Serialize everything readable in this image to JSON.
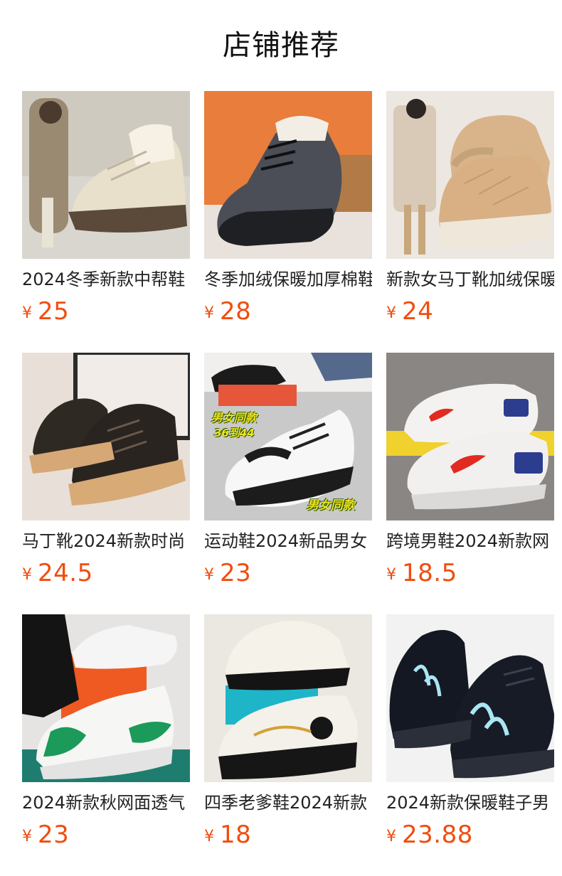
{
  "header": {
    "title": "店铺推荐"
  },
  "currency_symbol": "¥",
  "colors": {
    "price": "#f04d0f",
    "text": "#222222"
  },
  "products": [
    {
      "name": "2024冬季新款中帮鞋",
      "price": "25",
      "icon": "product-image-beige-lined-boots",
      "overlay_texts": []
    },
    {
      "name": "冬季加绒保暖加厚棉鞋",
      "price": "28",
      "icon": "product-image-dark-lined-sneaker",
      "overlay_texts": []
    },
    {
      "name": "新款女马丁靴加绒保暖",
      "price": "24",
      "icon": "product-image-quilted-snow-boots",
      "overlay_texts": []
    },
    {
      "name": "马丁靴2024新款时尚",
      "price": "24.5",
      "icon": "product-image-black-martin-boots",
      "overlay_texts": []
    },
    {
      "name": "运动鞋2024新品男女",
      "price": "23",
      "icon": "product-image-white-sport-shoe",
      "overlay_texts": [
        "男女同款",
        "36到44",
        "男女同款"
      ]
    },
    {
      "name": "跨境男鞋2024新款网",
      "price": "18.5",
      "icon": "product-image-white-red-blue-sneakers",
      "overlay_texts": []
    },
    {
      "name": "2024新款秋网面透气",
      "price": "23",
      "icon": "product-image-green-white-mesh-shoe",
      "overlay_texts": []
    },
    {
      "name": "四季老爹鞋2024新款",
      "price": "18",
      "icon": "product-image-black-white-dad-shoes",
      "overlay_texts": []
    },
    {
      "name": "2024新款保暖鞋子男",
      "price": "23.88",
      "icon": "product-image-black-knit-runners",
      "overlay_texts": []
    }
  ]
}
